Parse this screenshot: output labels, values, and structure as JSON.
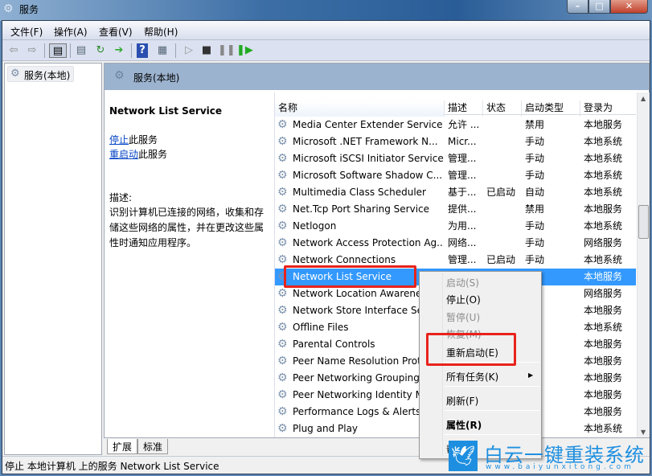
{
  "window": {
    "title": "服务",
    "controls": [
      "minimize",
      "maximize",
      "close"
    ]
  },
  "menubar": [
    "文件(F)",
    "操作(A)",
    "查看(V)",
    "帮助(H)"
  ],
  "toolbar": [
    "back-icon",
    "forward-icon",
    "show-hide-tree-icon",
    "properties-icon",
    "refresh-icon",
    "export-icon",
    "help-icon",
    "action-pane-icon",
    "start-icon",
    "stop-icon",
    "pause-icon",
    "resume-icon"
  ],
  "tree": {
    "item": "服务(本地)"
  },
  "panel": {
    "title": "服务(本地)",
    "service_name": "Network List Service",
    "stop_link": "停止",
    "stop_suffix": "此服务",
    "restart_link": "重启动",
    "restart_suffix": "此服务",
    "desc_label": "描述:",
    "desc": "识别计算机已连接的网络，收集和存储这些网络的属性，并在更改这些属性时通知应用程序。"
  },
  "columns": [
    "名称",
    "描述",
    "状态",
    "启动类型",
    "登录为"
  ],
  "rows": [
    [
      "Media Center Extender Service",
      "允许 ...",
      "",
      "禁用",
      "本地服务"
    ],
    [
      "Microsoft .NET Framework N...",
      "Micr...",
      "",
      "手动",
      "本地系统"
    ],
    [
      "Microsoft iSCSI Initiator Service",
      "管理...",
      "",
      "手动",
      "本地系统"
    ],
    [
      "Microsoft Software Shadow C...",
      "管理...",
      "",
      "手动",
      "本地系统"
    ],
    [
      "Multimedia Class Scheduler",
      "基于...",
      "已启动",
      "自动",
      "本地系统"
    ],
    [
      "Net.Tcp Port Sharing Service",
      "提供...",
      "",
      "禁用",
      "本地服务"
    ],
    [
      "Netlogon",
      "为用...",
      "",
      "手动",
      "本地系统"
    ],
    [
      "Network Access Protection Ag...",
      "网络...",
      "",
      "手动",
      "网络服务"
    ],
    [
      "Network Connections",
      "管理...",
      "已启动",
      "手动",
      "本地系统"
    ],
    [
      "Network List Service",
      "",
      "",
      "动",
      "本地服务"
    ],
    [
      "Network Location Awarene...",
      "",
      "",
      "动",
      "网络服务"
    ],
    [
      "Network Store Interface Se...",
      "",
      "",
      "动",
      "本地服务"
    ],
    [
      "Offline Files",
      "",
      "",
      "动",
      "本地系统"
    ],
    [
      "Parental Controls",
      "",
      "",
      "动",
      "本地服务"
    ],
    [
      "Peer Name Resolution Prot...",
      "",
      "",
      "动",
      "本地服务"
    ],
    [
      "Peer Networking Grouping",
      "",
      "",
      "动",
      "本地服务"
    ],
    [
      "Peer Networking Identity M...",
      "",
      "",
      "动",
      "本地服务"
    ],
    [
      "Performance Logs & Alerts",
      "",
      "",
      "动",
      "本地服务"
    ],
    [
      "Plug and Play",
      "",
      "",
      "动",
      "本地系统"
    ]
  ],
  "selected_row": "Network List Service",
  "tabs": [
    "扩展",
    "标准"
  ],
  "status": "停止 本地计算机 上的服务 Network List Service",
  "context_menu": [
    {
      "label": "启动(S)",
      "disabled": true
    },
    {
      "label": "停止(O)",
      "disabled": false
    },
    {
      "label": "暂停(U)",
      "disabled": true
    },
    {
      "label": "恢复(M)",
      "disabled": true
    },
    {
      "label": "重新启动(E)",
      "disabled": false
    },
    {
      "label": "所有任务(K)",
      "disabled": false,
      "submenu": true
    },
    {
      "label": "刷新(F)",
      "disabled": false
    },
    {
      "label": "属性(R)",
      "disabled": false,
      "bold": true
    },
    {
      "label": "帮",
      "disabled": false
    }
  ],
  "watermark": {
    "text": "白云一键重装系统",
    "url": "www.baiyunxitong.com"
  },
  "colors": {
    "selection": "#3399ff",
    "highlight_box": "#e8231c",
    "watermark": "#1e8fe0"
  }
}
